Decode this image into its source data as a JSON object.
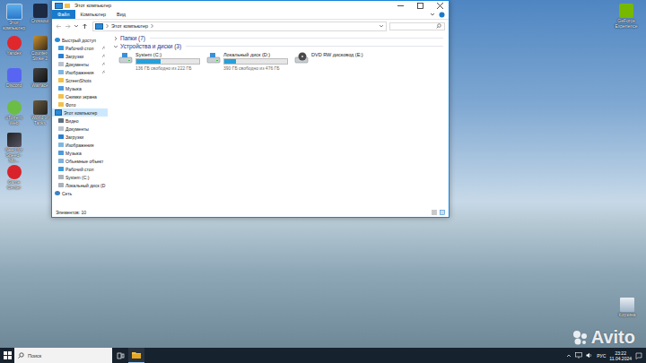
{
  "desktop": {
    "icon_columns": [
      {
        "icons": [
          {
            "label": "Этот компьютер",
            "kind": "computer"
          },
          {
            "label": "Yandex",
            "kind": "yandex"
          },
          {
            "label": "Discord",
            "kind": "discord"
          },
          {
            "label": "uTorrent Web",
            "kind": "utorrent"
          },
          {
            "label": "Need for Speed - Mo...",
            "kind": "nfs"
          },
          {
            "label": "Game Center",
            "kind": "game"
          }
        ]
      },
      {
        "icons": [
          {
            "label": "Crossout",
            "kind": "xo"
          },
          {
            "label": "Counter-Strike 2",
            "kind": "cs"
          },
          {
            "label": "Warface",
            "kind": "warface"
          },
          {
            "label": "World of Tanks",
            "kind": "tanks"
          }
        ]
      }
    ],
    "corner_icons": {
      "top": {
        "label": "GeForce Experience",
        "kind": "nvidia"
      },
      "bottom": {
        "label": "Корзина",
        "kind": "bin"
      }
    }
  },
  "window": {
    "title": "Этот компьютер",
    "ribbon_tabs": [
      {
        "label": "Файл",
        "selected": true
      },
      {
        "label": "Компьютер",
        "selected": false
      },
      {
        "label": "Вид",
        "selected": false
      }
    ],
    "address": {
      "path": "Этот компьютер"
    },
    "nav": [
      {
        "label": "Быстрый доступ",
        "kind": "star",
        "selected": false,
        "children": [
          {
            "label": "Рабочий стол",
            "kind": "desktop",
            "selected": false,
            "pinned": true
          },
          {
            "label": "Загрузки",
            "kind": "download",
            "selected": false,
            "pinned": true
          },
          {
            "label": "Документы",
            "kind": "docs",
            "selected": false,
            "pinned": true
          },
          {
            "label": "Изображения",
            "kind": "images",
            "selected": false,
            "pinned": true
          },
          {
            "label": "ScreenShots",
            "kind": "folder",
            "selected": false,
            "pinned": false
          },
          {
            "label": "Музыка",
            "kind": "music",
            "selected": false,
            "pinned": false
          },
          {
            "label": "Снимки экрана",
            "kind": "folder",
            "selected": false,
            "pinned": false
          },
          {
            "label": "Фото",
            "kind": "folder",
            "selected": false,
            "pinned": false
          }
        ]
      },
      {
        "label": "Этот компьютер",
        "kind": "computer",
        "selected": true,
        "children": [
          {
            "label": "Видео",
            "kind": "video",
            "selected": false,
            "pinned": false
          },
          {
            "label": "Документы",
            "kind": "docs",
            "selected": false,
            "pinned": false
          },
          {
            "label": "Загрузки",
            "kind": "download",
            "selected": false,
            "pinned": false
          },
          {
            "label": "Изображения",
            "kind": "images",
            "selected": false,
            "pinned": false
          },
          {
            "label": "Музыка",
            "kind": "music",
            "selected": false,
            "pinned": false
          },
          {
            "label": "Объемные объект",
            "kind": "objects",
            "selected": false,
            "pinned": false
          },
          {
            "label": "Рабочий стол",
            "kind": "desktop",
            "selected": false,
            "pinned": false
          },
          {
            "label": "System (C:)",
            "kind": "drive",
            "selected": false,
            "pinned": false
          },
          {
            "label": "Локальный диск (D",
            "kind": "drive",
            "selected": false,
            "pinned": false
          }
        ]
      },
      {
        "label": "Сеть",
        "kind": "network",
        "selected": false,
        "children": []
      }
    ],
    "groups": [
      {
        "label": "Папки (7)",
        "expanded": false,
        "items": []
      },
      {
        "label": "Устройства и диски (3)",
        "expanded": true,
        "items": [
          {
            "name": "System (C:)",
            "kind": "drive",
            "level": 0.39,
            "free": "136 ГБ свободно из 222 ГБ"
          },
          {
            "name": "Локальный диск (D:)",
            "kind": "drive",
            "level": 0.18,
            "free": "390 ГБ свободно из 476 ГБ"
          },
          {
            "name": "DVD RW дисковод (E:)",
            "kind": "dvd",
            "level": 0,
            "free": ""
          }
        ]
      }
    ],
    "status_bar": {
      "items": "Элементов: 10"
    }
  },
  "taskbar": {
    "search": {
      "placeholder": "Поиск"
    },
    "pinned": [
      {
        "kind": "explorer",
        "active": true
      }
    ],
    "tray": {
      "language": "РУС",
      "time": "23:22",
      "date": "11.04.2024"
    }
  },
  "watermark": {
    "text": "Avito"
  }
}
